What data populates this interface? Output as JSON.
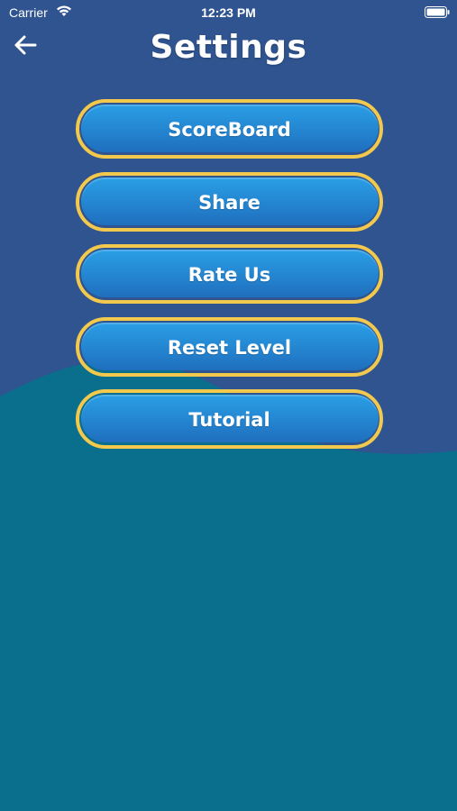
{
  "status_bar": {
    "carrier": "Carrier",
    "time": "12:23 PM",
    "wifi_icon": "wifi-icon",
    "battery_icon": "battery-icon"
  },
  "header": {
    "back_icon": "arrow-left-icon",
    "title": "Settings"
  },
  "menu": {
    "items": [
      {
        "label": "ScoreBoard"
      },
      {
        "label": "Share"
      },
      {
        "label": "Rate Us"
      },
      {
        "label": "Reset Level"
      },
      {
        "label": "Tutorial"
      }
    ]
  },
  "colors": {
    "background_top": "#2f5490",
    "background_bottom": "#0a6f8c",
    "button_outline": "#f2c94c",
    "button_top": "#2a9fe6",
    "button_bottom": "#1f6fbe",
    "text": "#ffffff"
  }
}
